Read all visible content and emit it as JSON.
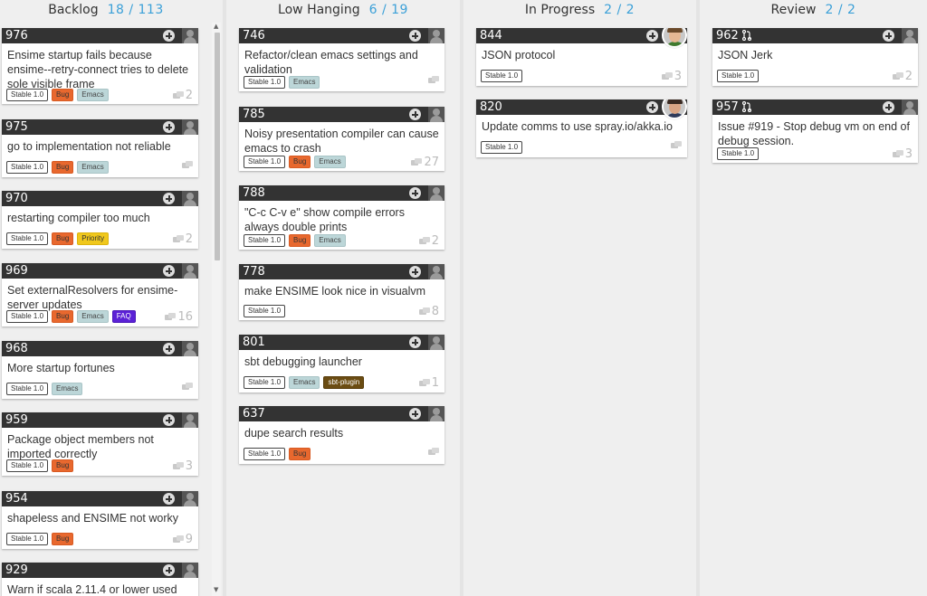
{
  "columns": [
    {
      "name": "Backlog",
      "count": "18 / 113"
    },
    {
      "name": "Low Hanging",
      "count": "6 / 19"
    },
    {
      "name": "In Progress",
      "count": "2 / 2"
    },
    {
      "name": "Review",
      "count": "2 / 2"
    }
  ],
  "backlog": [
    {
      "number": "976",
      "title": "Ensime startup fails because ensime--retry-connect tries to delete sole visible frame",
      "labels": [
        "Stable 1.0",
        "Bug",
        "Emacs"
      ],
      "comments": "2"
    },
    {
      "number": "975",
      "title": "go to implementation not reliable",
      "labels": [
        "Stable 1.0",
        "Bug",
        "Emacs"
      ],
      "comments": ""
    },
    {
      "number": "970",
      "title": "restarting compiler too much",
      "labels": [
        "Stable 1.0",
        "Bug",
        "Priority"
      ],
      "comments": "2"
    },
    {
      "number": "969",
      "title": "Set externalResolvers for ensime-server updates",
      "labels": [
        "Stable 1.0",
        "Bug",
        "Emacs",
        "FAQ"
      ],
      "comments": "16"
    },
    {
      "number": "968",
      "title": "More startup fortunes",
      "labels": [
        "Stable 1.0",
        "Emacs"
      ],
      "comments": ""
    },
    {
      "number": "959",
      "title": "Package object members not imported correctly",
      "labels": [
        "Stable 1.0",
        "Bug"
      ],
      "comments": "3"
    },
    {
      "number": "954",
      "title": "shapeless and ENSIME not worky",
      "labels": [
        "Stable 1.0",
        "Bug"
      ],
      "comments": "9"
    },
    {
      "number": "929",
      "title": "Warn if scala 2.11.4 or lower used",
      "labels": [],
      "comments": ""
    }
  ],
  "low_hanging": [
    {
      "number": "746",
      "title": "Refactor/clean emacs settings and validation",
      "labels": [
        "Stable 1.0",
        "Emacs"
      ],
      "comments": ""
    },
    {
      "number": "785",
      "title": "Noisy presentation compiler can cause emacs to crash",
      "labels": [
        "Stable 1.0",
        "Bug",
        "Emacs"
      ],
      "comments": "27"
    },
    {
      "number": "788",
      "title": "\"C-c C-v e\" show compile errors always double prints",
      "labels": [
        "Stable 1.0",
        "Bug",
        "Emacs"
      ],
      "comments": "2"
    },
    {
      "number": "778",
      "title": "make ENSIME look nice in visualvm",
      "labels": [
        "Stable 1.0"
      ],
      "comments": "8"
    },
    {
      "number": "801",
      "title": "sbt debugging launcher",
      "labels": [
        "Stable 1.0",
        "Emacs",
        "sbt-plugin"
      ],
      "comments": "1"
    },
    {
      "number": "637",
      "title": "dupe search results",
      "labels": [
        "Stable 1.0",
        "Bug"
      ],
      "comments": ""
    }
  ],
  "in_progress": [
    {
      "number": "844",
      "title": "JSON protocol",
      "labels": [
        "Stable 1.0"
      ],
      "comments": "3"
    },
    {
      "number": "820",
      "title": "Update comms to use spray.io/akka.io",
      "labels": [
        "Stable 1.0"
      ],
      "comments": ""
    }
  ],
  "review": [
    {
      "number": "962",
      "title": "JSON Jerk",
      "labels": [
        "Stable 1.0"
      ],
      "comments": "2"
    },
    {
      "number": "957",
      "title": "Issue #919 - Stop debug vm on end of debug session.",
      "labels": [
        "Stable 1.0"
      ],
      "comments": "3"
    }
  ],
  "icons": {
    "add": "plus-circle-icon",
    "assignee": "person-icon",
    "comments": "speech-bubbles-icon",
    "pull_request": "pull-request-icon"
  },
  "colors": {
    "count": "#3ba0d8",
    "card_header": "#333333",
    "bug": "#e8682e",
    "emacs": "#bcd6d8",
    "priority": "#f0c81c",
    "faq": "#5b21d6",
    "sbt_plugin": "#6b4c12"
  }
}
